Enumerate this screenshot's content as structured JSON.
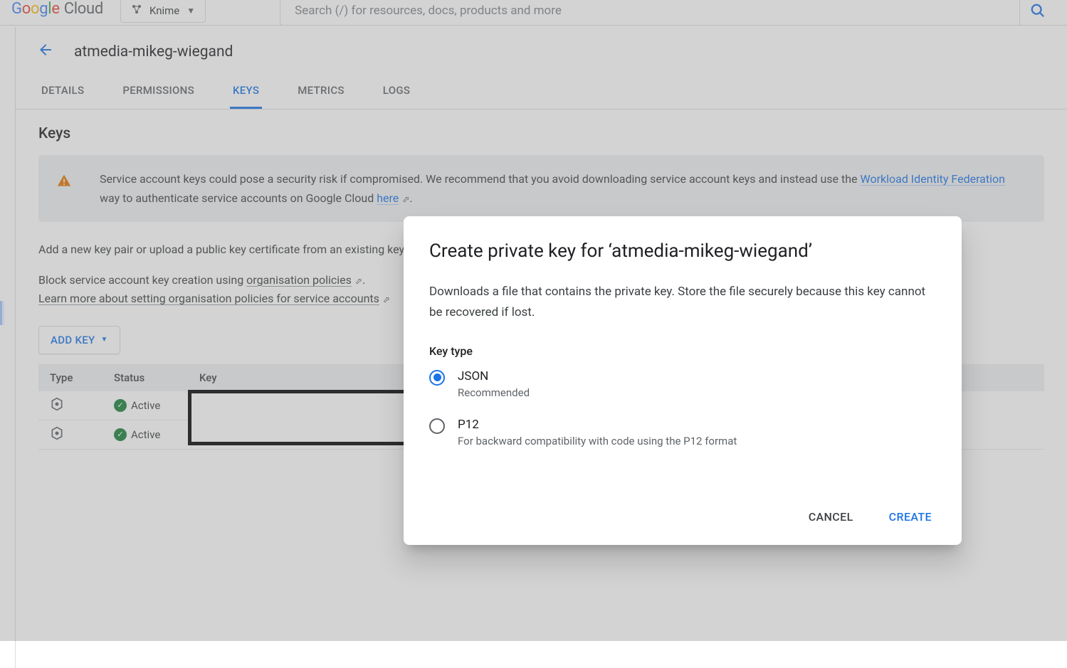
{
  "topbar": {
    "logo_cloud": "Cloud",
    "project_name": "Knime",
    "search_placeholder": "Search (/) for resources, docs, products and more"
  },
  "page": {
    "title": "atmedia-mikeg-wiegand",
    "tabs": [
      "DETAILS",
      "PERMISSIONS",
      "KEYS",
      "METRICS",
      "LOGS"
    ],
    "active_tab": "KEYS",
    "section_title": "Keys",
    "warning_text_a": "Service account keys could pose a security risk if compromised. We recommend that you avoid downloading service account keys and instead use the ",
    "warning_link1": "Workload Identity Federation",
    "warning_text_b": " way to authenticate service accounts on Google Cloud ",
    "warning_link2": "here",
    "warning_text_c": ".",
    "para1": "Add a new key pair or upload a public key certificate from an existing key pair.",
    "para2a": "Block service account key creation using ",
    "para2_link": "organisation policies",
    "para2b": ".",
    "para3_link": "Learn more about setting organisation policies for service accounts",
    "add_key_label": "ADD KEY",
    "table": {
      "headers": [
        "Type",
        "Status",
        "Key"
      ],
      "rows": [
        {
          "status": "Active"
        },
        {
          "status": "Active"
        }
      ]
    }
  },
  "dialog": {
    "title": "Create private key for ‘atmedia-mikeg-wiegand’",
    "description": "Downloads a file that contains the private key. Store the file securely because this key cannot be recovered if lost.",
    "keytype_label": "Key type",
    "options": [
      {
        "label": "JSON",
        "sub": "Recommended",
        "selected": true
      },
      {
        "label": "P12",
        "sub": "For backward compatibility with code using the P12 format",
        "selected": false
      }
    ],
    "cancel": "CANCEL",
    "create": "CREATE"
  }
}
